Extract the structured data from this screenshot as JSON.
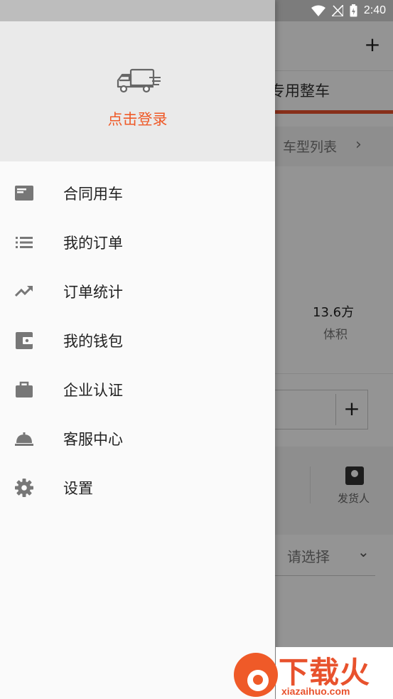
{
  "status_bar": {
    "time": "2:40"
  },
  "background": {
    "tab_label": "专用整车",
    "model_list_label": "车型列表",
    "volume_value": "13.6方",
    "volume_label": "体积",
    "contact_label": "发货人",
    "select_placeholder": "请选择"
  },
  "drawer": {
    "login_label": "点击登录",
    "menu_items": [
      {
        "label": "合同用车",
        "icon": "contract-card-icon"
      },
      {
        "label": "我的订单",
        "icon": "list-icon"
      },
      {
        "label": "订单统计",
        "icon": "trending-up-icon"
      },
      {
        "label": "我的钱包",
        "icon": "wallet-icon"
      },
      {
        "label": "企业认证",
        "icon": "briefcase-icon"
      },
      {
        "label": "客服中心",
        "icon": "service-bell-icon"
      },
      {
        "label": "设置",
        "icon": "gear-icon"
      }
    ]
  },
  "watermark": {
    "text": "下载火",
    "url": "xiazaihuo.com"
  },
  "colors": {
    "accent": "#ef5a28",
    "icon": "#777777"
  }
}
